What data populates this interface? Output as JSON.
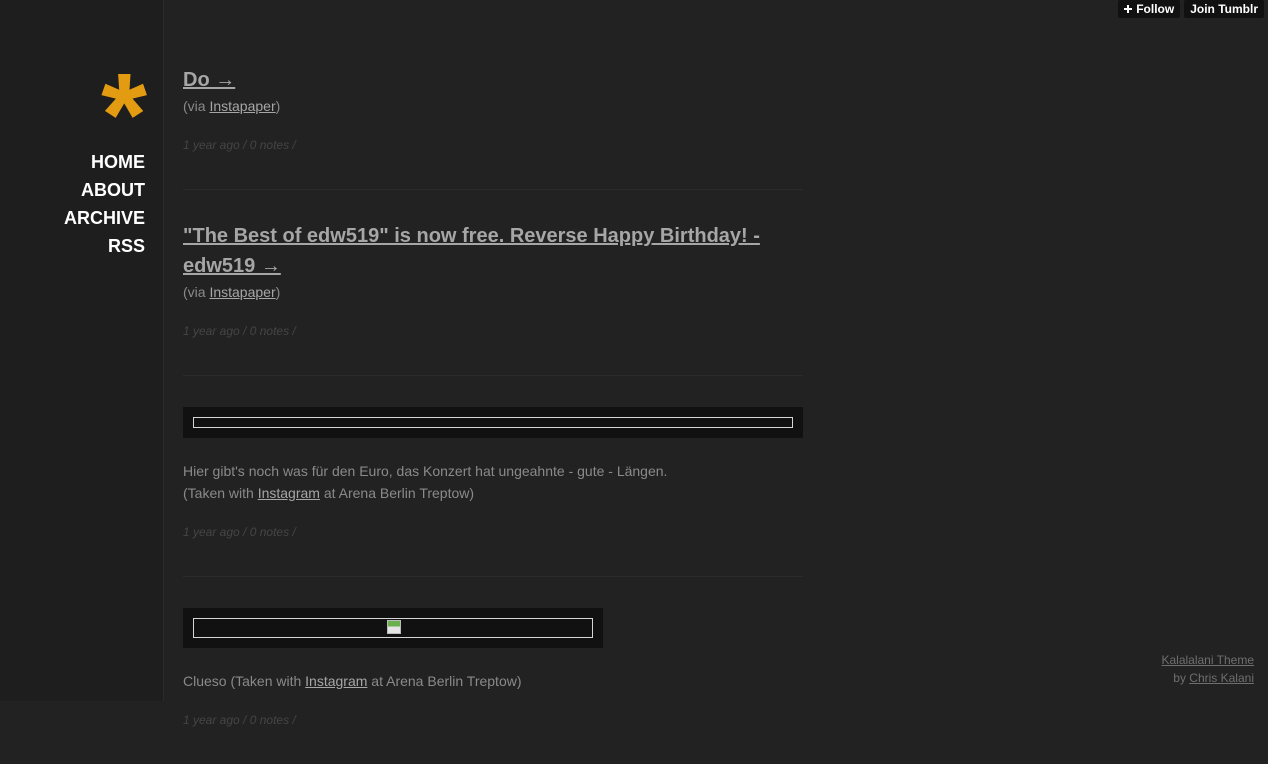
{
  "topbar": {
    "follow_label": "Follow",
    "join_label": "Join Tumblr"
  },
  "sidebar": {
    "logo": "*",
    "nav": [
      "HOME",
      "ABOUT",
      "ARCHIVE",
      "RSS"
    ]
  },
  "posts": [
    {
      "title": "Do →",
      "via_prefix": "(via ",
      "via_link": "Instapaper",
      "via_suffix": ")",
      "meta": "1 year ago  /  0 notes  /"
    },
    {
      "title": "\"The Best of edw519\" is now free. Reverse Happy Birthday! - edw519 →",
      "via_prefix": "(via ",
      "via_link": "Instapaper",
      "via_suffix": ")",
      "meta": "1 year ago  /  0 notes  /"
    },
    {
      "caption_line1": "Hier gibt's noch was für den Euro, das Konzert hat ungeahnte - gute - Längen.",
      "caption_prefix": "(Taken with ",
      "caption_link": "Instagram",
      "caption_suffix": " at Arena Berlin Treptow)",
      "meta": "1 year ago  /  0 notes  /"
    },
    {
      "caption_prefix": "Clueso (Taken with ",
      "caption_link": "Instagram",
      "caption_suffix": " at Arena Berlin Treptow)",
      "meta": "1 year ago  /  0 notes  /"
    }
  ],
  "footer": {
    "theme": "Kalalalani Theme",
    "by_prefix": "by ",
    "author": "Chris Kalani"
  },
  "colors": {
    "background": "#222222",
    "sidebar": "#1e1e1e",
    "accent": "#e39b12",
    "text": "#808080"
  }
}
